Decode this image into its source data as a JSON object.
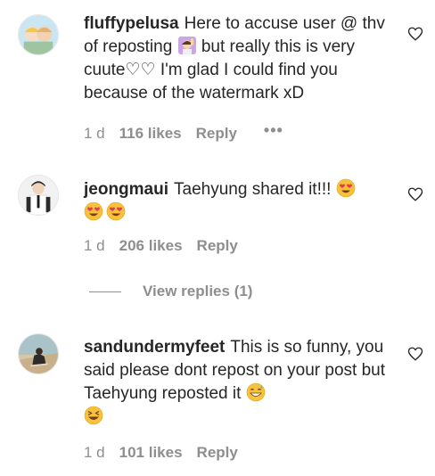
{
  "comments": [
    {
      "username": "fluffypelusa",
      "text_before_emoji": "Here to accuse user @ thv of reposting",
      "text_after_emoji": "but really this is very cuute♡♡ I'm glad I could find you because of the watermark xD",
      "emoji_inline": "raising-hand-emoji",
      "time": "1 d",
      "likes": "116 likes",
      "reply": "Reply",
      "more": "•••"
    },
    {
      "username": "jeongmaui",
      "text": "Taehyung shared it!!!",
      "emojis": [
        "heart-eyes-emoji",
        "heart-eyes-emoji",
        "heart-eyes-emoji"
      ],
      "time": "1 d",
      "likes": "206 likes",
      "reply": "Reply"
    },
    {
      "username": "sandundermyfeet",
      "text": "This is so funny, you said please dont repost on your post but Taehyung reposted it",
      "emojis": [
        "grinning-sweat-emoji",
        "laughing-squint-emoji"
      ],
      "time": "1 d",
      "likes": "101 likes",
      "reply": "Reply"
    }
  ],
  "view_replies": "View replies (1)",
  "colors": {
    "text": "#262626",
    "secondary": "#8e8e8e",
    "emoji_yellow": "#f7c23b",
    "heart_red": "#e8365c"
  }
}
